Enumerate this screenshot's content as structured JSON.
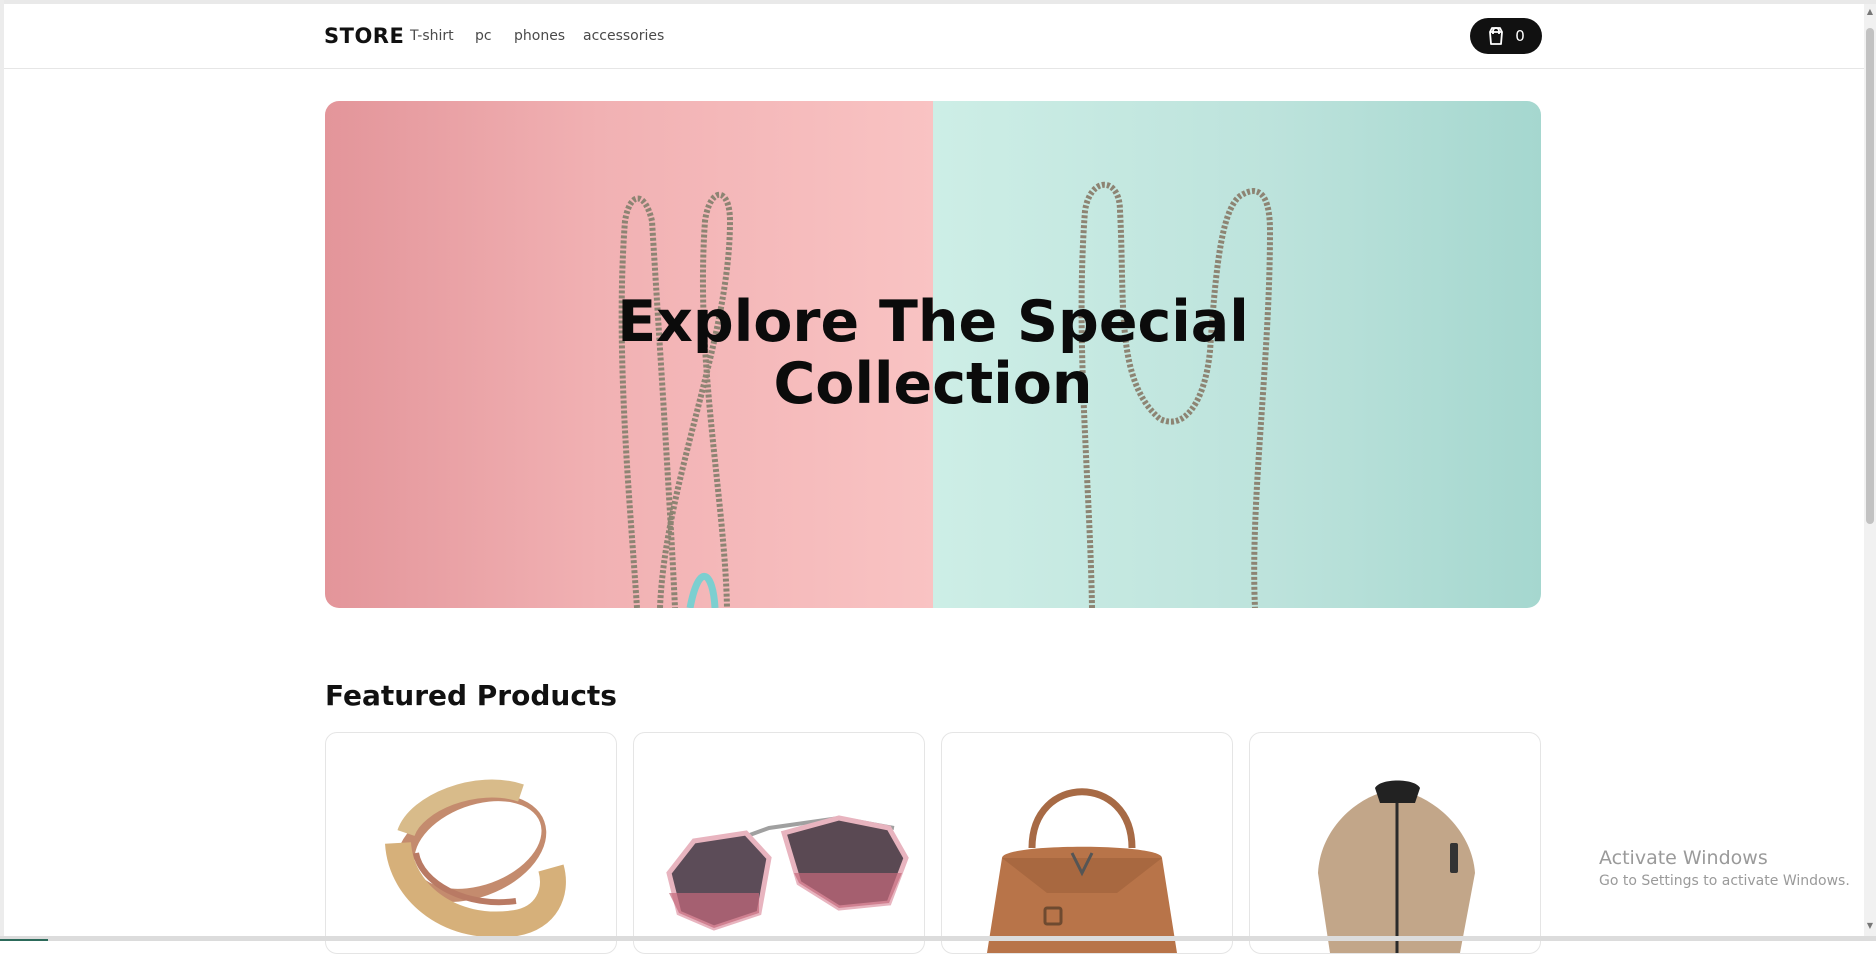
{
  "navbar": {
    "brand": "STORE",
    "links": [
      {
        "label": "T-shirt"
      },
      {
        "label": "pc"
      },
      {
        "label": "phones"
      },
      {
        "label": "accessories"
      }
    ],
    "cart": {
      "count": "0",
      "icon": "shopping-bag-icon"
    }
  },
  "hero": {
    "title_line1": "Explore The Special",
    "title_line2": "Collection",
    "colors": {
      "left": "#f4b7b8",
      "right": "#bfe5de"
    }
  },
  "featured": {
    "title": "Featured Products",
    "products": [
      {
        "image": "bracelet-image"
      },
      {
        "image": "sunglasses-image"
      },
      {
        "image": "handbag-image"
      },
      {
        "image": "jacket-image"
      }
    ]
  },
  "watermark": {
    "title": "Activate Windows",
    "subtitle": "Go to Settings to activate Windows."
  }
}
